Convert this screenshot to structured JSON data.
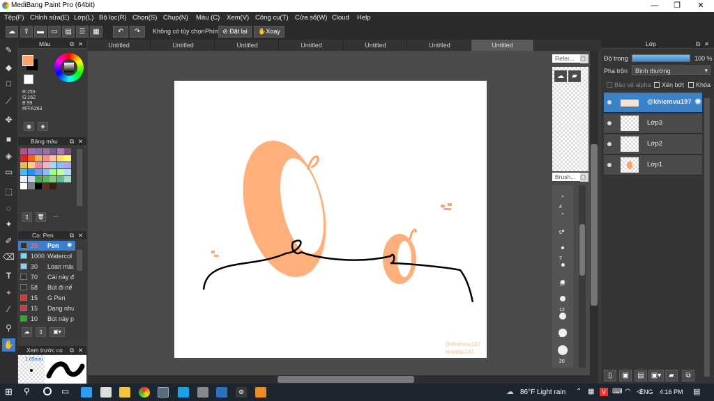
{
  "app": {
    "title": "MediBang Paint Pro (64bit)",
    "min": "—",
    "max": "❐",
    "close": "✕"
  },
  "menu": [
    "Tệp(F)",
    "Chỉnh sửa(E)",
    "Lớp(L)",
    "Bộ lọc(R)",
    "Chọn(S)",
    "Chụp(N)",
    "Màu (C)",
    "Xem(V)",
    "Công cụ(T)",
    "Cửa sổ(W)",
    "Cloud",
    "Help"
  ],
  "toolbar": {
    "no_selection": "Không có tùy chọn",
    "key_label": "Phím",
    "reset": "Đặt lại",
    "rotate": "Xoay"
  },
  "tabs": [
    "Untitled",
    "Untitled",
    "Untitled",
    "Untitled",
    "Untitled",
    "Untitled",
    "Untitled"
  ],
  "color_panel": {
    "title": "Màu",
    "r": "R:255",
    "g": "G:162",
    "b": "B:99",
    "hex": "#FFA263",
    "accent": "#FFA263"
  },
  "palette_panel": {
    "title": "Bảng màu",
    "dash": "---"
  },
  "brush_panel": {
    "title": "Cọ: Pen",
    "items": [
      {
        "size": "20",
        "name": "Pen",
        "color": "#333"
      },
      {
        "size": "1000",
        "name": "Watercol",
        "color": "#7ad7f0"
      },
      {
        "size": "30",
        "name": "Loan màu",
        "color": "#7ad7f0"
      },
      {
        "size": "70",
        "name": "Cái này đ",
        "color": "#333"
      },
      {
        "size": "58",
        "name": "Bút đi nế",
        "color": "#333"
      },
      {
        "size": "15",
        "name": "G Pen",
        "color": "#e53030"
      },
      {
        "size": "15",
        "name": "Dạng nhu",
        "color": "#e53030"
      },
      {
        "size": "10",
        "name": "Bút này p",
        "color": "#2ab02a"
      }
    ]
  },
  "preview_panel": {
    "title": "Xem trước co",
    "size": "1.69mm"
  },
  "reference_panel": {
    "title": "Refer..."
  },
  "brush_size_panel": {
    "title": "Brush...",
    "sizes": [
      "4",
      "5",
      "7",
      "10",
      "12",
      "15",
      "20"
    ]
  },
  "layer_panel": {
    "title": "Lớp",
    "opacity_label": "Độ trong",
    "opacity_value": "100 %",
    "opacity": 1.0,
    "blend_label": "Pha trộn",
    "blend_value": "Bình thường",
    "protect_alpha": "Bảo vệ alpha",
    "clip": "Xén bớt",
    "lock": "Khóa",
    "layers": [
      {
        "name": "@khiemvu197",
        "selected": true
      },
      {
        "name": "Lớp3",
        "selected": false
      },
      {
        "name": "Lớp2",
        "selected": false
      },
      {
        "name": "Lớp1",
        "selected": false
      }
    ]
  },
  "canvas": {
    "watermark1": "@khiemvu197",
    "watermark2": "#hoidap247"
  },
  "taskbar": {
    "weather": "86°F  Light rain",
    "lang": "ENG",
    "time": "4:16 PM"
  }
}
